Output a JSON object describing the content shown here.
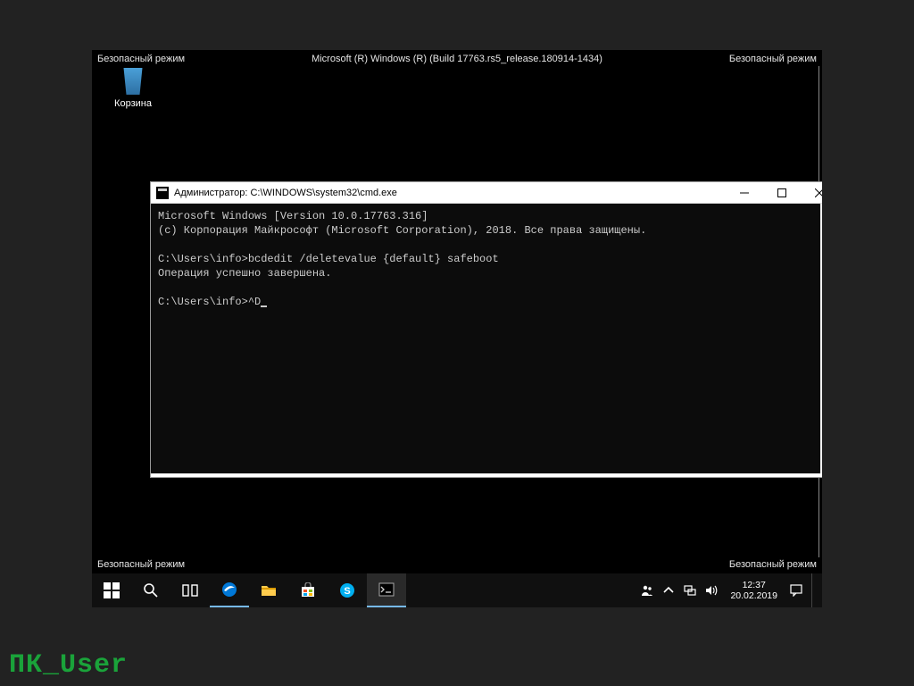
{
  "safe_mode_label": "Безопасный режим",
  "build_info": "Microsoft (R) Windows (R) (Build 17763.rs5_release.180914-1434)",
  "recycle_bin_label": "Корзина",
  "cmd": {
    "title": "Администратор: C:\\WINDOWS\\system32\\cmd.exe",
    "line1": "Microsoft Windows [Version 10.0.17763.316]",
    "line2": "(c) Корпорация Майкрософт (Microsoft Corporation), 2018. Все права защищены.",
    "prompt1": "C:\\Users\\info>bcdedit /deletevalue {default} safeboot",
    "result1": "Операция успешно завершена.",
    "prompt2": "C:\\Users\\info>^D"
  },
  "taskbar": {
    "time": "12:37",
    "date": "20.02.2019"
  },
  "watermark": "ПК_User"
}
